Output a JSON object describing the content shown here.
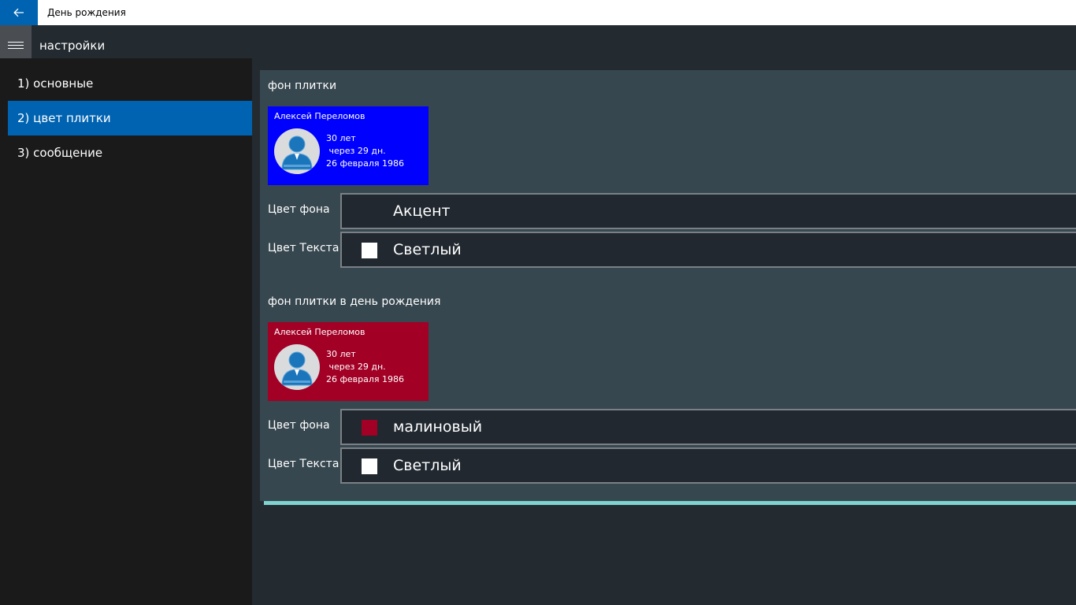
{
  "window": {
    "title": "День рождения"
  },
  "header": {
    "title": "настройки"
  },
  "sidebar": {
    "items": [
      {
        "label": "1) основные",
        "active": false
      },
      {
        "label": "2) цвет плитки",
        "active": true
      },
      {
        "label": "3) сообщение",
        "active": false
      }
    ]
  },
  "sections": [
    {
      "title": "фон плитки",
      "tile": {
        "bg_color": "#0000ff",
        "name": "Алексей Переломов",
        "age": "30 лет",
        "until": " через 29 дн.",
        "date": "26 февраля 1986"
      },
      "bg_label": "Цвет фона",
      "bg_value": "Акцент",
      "bg_swatch": "",
      "text_label": "Цвет Текста",
      "text_value": "Светлый",
      "text_swatch": "#ffffff"
    },
    {
      "title": "фон плитки в день рождения",
      "tile": {
        "bg_color": "#a20025",
        "name": "Алексей Переломов",
        "age": "30 лет",
        "until": " через 29 дн.",
        "date": "26 февраля 1986"
      },
      "bg_label": "Цвет фона",
      "bg_value": "малиновый",
      "bg_swatch": "#a20025",
      "text_label": "Цвет Текста",
      "text_value": "Светлый",
      "text_swatch": "#ffffff"
    }
  ],
  "colors": {
    "accent": "#0063b1",
    "progress": "#7fd3d0"
  }
}
